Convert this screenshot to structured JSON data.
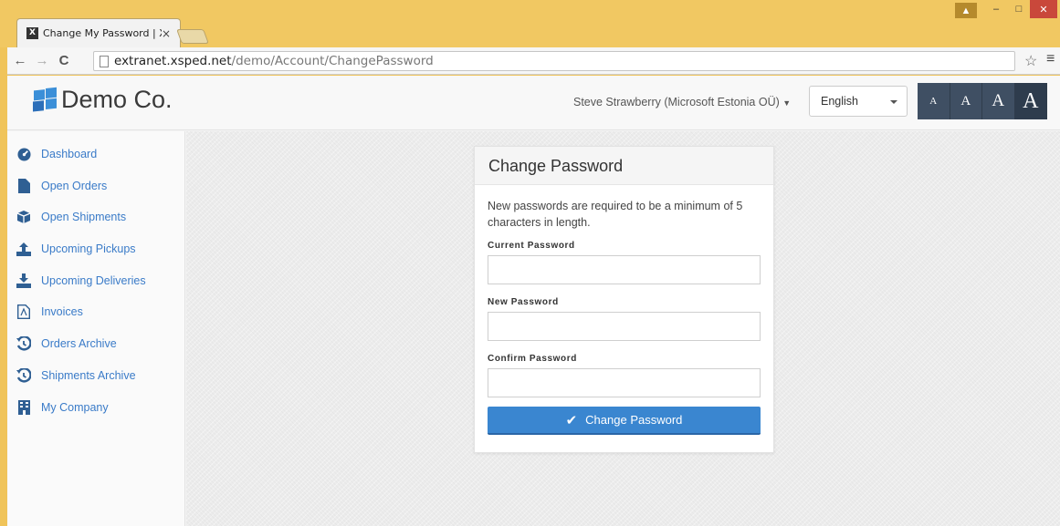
{
  "browser": {
    "tab_title": "Change My Password | XS",
    "tab_favicon": "X",
    "tab_close": "×",
    "url_host": "extranet.xsped.net",
    "url_path": "/demo/Account/ChangePassword"
  },
  "header": {
    "logo_text": "Demo Co.",
    "user_menu": "Steve Strawberry (Microsoft Estonia OÜ)",
    "language": "English",
    "font_sizes": [
      "A",
      "A",
      "A",
      "A"
    ]
  },
  "sidebar": {
    "items": [
      {
        "label": "Dashboard",
        "icon": "dashboard-icon"
      },
      {
        "label": "Open Orders",
        "icon": "file-icon"
      },
      {
        "label": "Open Shipments",
        "icon": "box-icon"
      },
      {
        "label": "Upcoming Pickups",
        "icon": "upload-icon"
      },
      {
        "label": "Upcoming Deliveries",
        "icon": "download-icon"
      },
      {
        "label": "Invoices",
        "icon": "pdf-icon"
      },
      {
        "label": "Orders Archive",
        "icon": "history-icon"
      },
      {
        "label": "Shipments Archive",
        "icon": "history-icon"
      },
      {
        "label": "My Company",
        "icon": "building-icon"
      }
    ]
  },
  "form": {
    "title": "Change Password",
    "note": "New passwords are required to be a minimum of 5 characters in length.",
    "current_label": "Current Password",
    "new_label": "New Password",
    "confirm_label": "Confirm Password",
    "submit_label": "Change Password"
  },
  "colors": {
    "accent": "#3a86d0",
    "link": "#3a7bc8",
    "chrome_frame": "#f1c862"
  }
}
